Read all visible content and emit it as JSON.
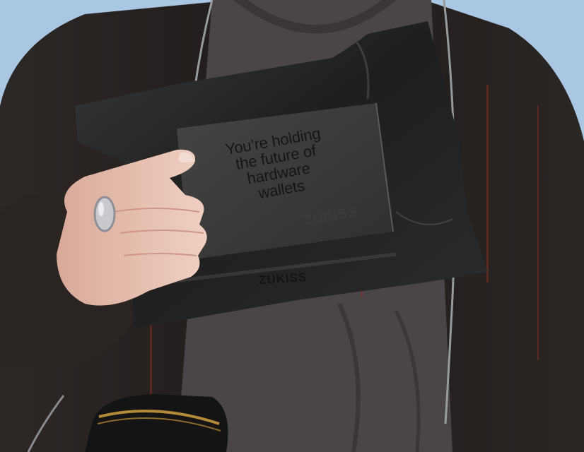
{
  "photo": {
    "box_message": "You’re holding\nthe future of\nhardware\nwallets",
    "brand_logo": "ZUKISS",
    "colors": {
      "sky": "#a9c6e2",
      "jacket": "#262220",
      "tshirt": "#4a4647",
      "bag": "#232323",
      "box": "#383838",
      "skin": "#e9c4b3",
      "ring": "#c7c9cc",
      "red_streak": "#8a2f22"
    }
  }
}
